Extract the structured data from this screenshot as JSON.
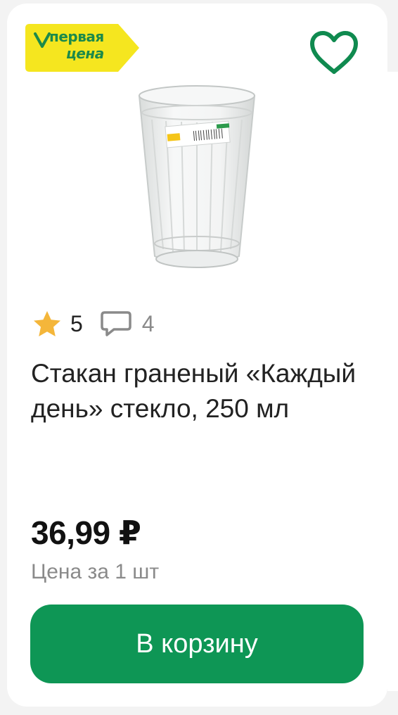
{
  "badge": {
    "line1": "первая",
    "line2": "цена",
    "bg_color": "#f5e61f",
    "text_color": "#1c8a4a"
  },
  "favorite": {
    "icon": "heart-icon",
    "color": "#0f8a4f"
  },
  "product": {
    "image_icon": "faceted-glass-image",
    "rating": "5",
    "reviews_count": "4",
    "title": "Стакан граненый «Каждый день» стекло, 250 мл",
    "price": "36,99 ₽",
    "unit_note": "Цена за 1 шт"
  },
  "cart_button": {
    "label": "В корзину",
    "color": "#0e9655"
  },
  "colors": {
    "star": "#f4b63a",
    "accent_green": "#0e9655",
    "muted_text": "#8a8a8a"
  }
}
